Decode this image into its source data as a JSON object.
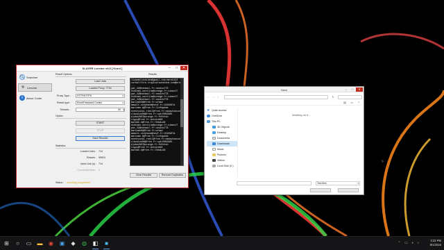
{
  "app": {
    "title": "SLAYER Leecher v0.6 [ Kroni ]",
    "sidebar": [
      {
        "label": "Searcher",
        "icon": "magnifier-icon"
      },
      {
        "label": "Leecher",
        "icon": "tools-icon",
        "active": true
      },
      {
        "label": "About Coder",
        "icon": "info-icon"
      }
    ],
    "result_options_label": "Result Options",
    "load_links_btn": "Load Links",
    "load_proxy_btn": "Loaded Proxy: 7724",
    "proxy_type_label": "Proxy Type :",
    "proxy_type_value": "HTTP/HTTPS",
    "result_type_label": "Result type :",
    "result_type_value": "Email:Password Combo",
    "threads_label": "Threads :",
    "threads_value": "50",
    "option_label": "Option",
    "start_btn": "START",
    "stop_btn": "STOP",
    "save_results_btn": "Save Results!",
    "statistics_label": "Statistics",
    "stats": [
      {
        "label": "Loaded Links :",
        "value": "714"
      },
      {
        "label": "Results :",
        "value": "59924"
      },
      {
        "label": "Used Link (s) :",
        "value": "714"
      },
      {
        "label": "Connected Bots :",
        "value": "0"
      }
    ],
    "status_label": "Status :",
    "status_value": "Leeching Completed !",
    "results_label": "Results",
    "results_lines": [
      "lizaemcloseidee@gmail.com:merek123",
      "curballfire.tropicalsunshine.com@orange.fr:simon",
      "...",
      "pat_42@hotmail.fr:casino778",
      "didiemo.caroline@orange.fr:simon17",
      "pat_42@hotmail.fr:casino778",
      "didiemo.caroline@orange.fr:simon17",
      "pat_42@hotmail.fr:casino778",
      "marieme98@free.fr:wrbad",
      "amault.stephane@neuf.fr:1010987a",
      "marieme.b@free.fr:linfapede",
      "eventouski.reeil@free.fr:newswtsecoddes",
      "claudine68@free.fr:cp4r0081965",
      "djuba2807@orange.fr:fdfchie",
      "tiguy@free.fr:antoine92",
      "mareme.b@free.fr:72bb4u38",
      "didiemo.caroline@orange.fr:simon17",
      "pat_42@hotmail.fr:casino778",
      "marieme98@free.fr:wrbad",
      "amault.stephane@neuf.fr:1010987a",
      "marieme.b@free.fr:linfapede",
      "eventouski.reeil@free.fr:newswtsecoddes",
      "claudine68@free.fr:cp4r0081965",
      "djuba2807@orange.fr:fdfchie",
      "tiguy@free.fr:antoine92",
      "mareme.b@free.fr:72bb4u38"
    ],
    "clear_results_btn": "Clear Results!",
    "remove_duplicates_btn": "Remove Duplicates"
  },
  "explorer": {
    "title": "Save",
    "working": "Working on it...",
    "nav": [
      {
        "label": "Quick access",
        "icon": "star-icon",
        "sub": false
      },
      {
        "label": "OneDrive",
        "icon": "cloud-icon",
        "sub": false
      },
      {
        "label": "This PC",
        "icon": "computer-icon",
        "sub": false
      },
      {
        "label": "3D Objects",
        "icon": "cube-icon",
        "sub": true
      },
      {
        "label": "Desktop",
        "icon": "desktop-icon",
        "sub": true
      },
      {
        "label": "Documents",
        "icon": "documents-icon",
        "sub": true
      },
      {
        "label": "Downloads",
        "icon": "downloads-icon",
        "sub": true,
        "selected": true
      },
      {
        "label": "Music",
        "icon": "music-icon",
        "sub": true
      },
      {
        "label": "Pictures",
        "icon": "pictures-icon",
        "sub": true
      },
      {
        "label": "Videos",
        "icon": "videos-icon",
        "sub": true
      },
      {
        "label": "Local Disk (C:)",
        "icon": "disk-icon",
        "sub": true
      }
    ],
    "file_type": "Text files"
  },
  "taskbar": {
    "time": "3:32 PM",
    "date": "8/1/2018"
  },
  "colors": {
    "accent": "#c42b1c",
    "results_bg": "#111111",
    "status_text": "#e0a000"
  }
}
